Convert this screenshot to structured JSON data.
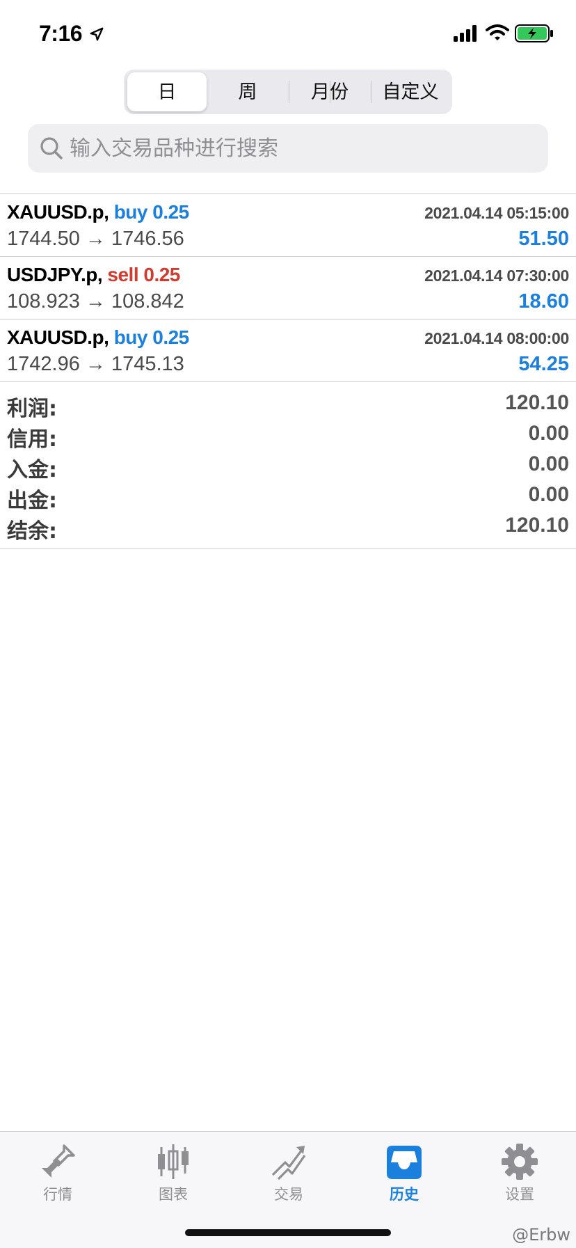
{
  "status_bar": {
    "time": "7:16",
    "icons": [
      "location-arrow-icon",
      "signal-icon",
      "wifi-icon",
      "battery-charging-icon"
    ]
  },
  "period_tabs": {
    "items": [
      {
        "label": "日",
        "active": true
      },
      {
        "label": "周",
        "active": false
      },
      {
        "label": "月份",
        "active": false
      },
      {
        "label": "自定义",
        "active": false
      }
    ]
  },
  "search": {
    "placeholder": "输入交易品种进行搜索",
    "value": ""
  },
  "deals": [
    {
      "symbol": "XAUUSD.p,",
      "side": "buy 0.25",
      "type": "buy",
      "time": "2021.04.14 05:15:00",
      "prices": "1744.50 → 1746.56",
      "profit": "51.50"
    },
    {
      "symbol": "USDJPY.p,",
      "side": "sell 0.25",
      "type": "sell",
      "time": "2021.04.14 07:30:00",
      "prices": "108.923 → 108.842",
      "profit": "18.60"
    },
    {
      "symbol": "XAUUSD.p,",
      "side": "buy 0.25",
      "type": "buy",
      "time": "2021.04.14 08:00:00",
      "prices": "1742.96 → 1745.13",
      "profit": "54.25"
    }
  ],
  "summary": [
    {
      "label": "利润:",
      "value": "120.10"
    },
    {
      "label": "信用:",
      "value": "0.00"
    },
    {
      "label": "入金:",
      "value": "0.00"
    },
    {
      "label": "出金:",
      "value": "0.00"
    },
    {
      "label": "结余:",
      "value": "120.10"
    }
  ],
  "tab_bar": {
    "items": [
      {
        "label": "行情",
        "icon": "quotes-arrows-icon",
        "active": false
      },
      {
        "label": "图表",
        "icon": "candlestick-chart-icon",
        "active": false
      },
      {
        "label": "交易",
        "icon": "trade-chart-icon",
        "active": false
      },
      {
        "label": "历史",
        "icon": "history-inbox-icon",
        "active": true
      },
      {
        "label": "设置",
        "icon": "gear-icon",
        "active": false
      }
    ]
  },
  "colors": {
    "accent": "#1b7fdd",
    "sell": "#d23c2e",
    "inactive": "#8e8e93"
  },
  "watermark": "@Erbw"
}
